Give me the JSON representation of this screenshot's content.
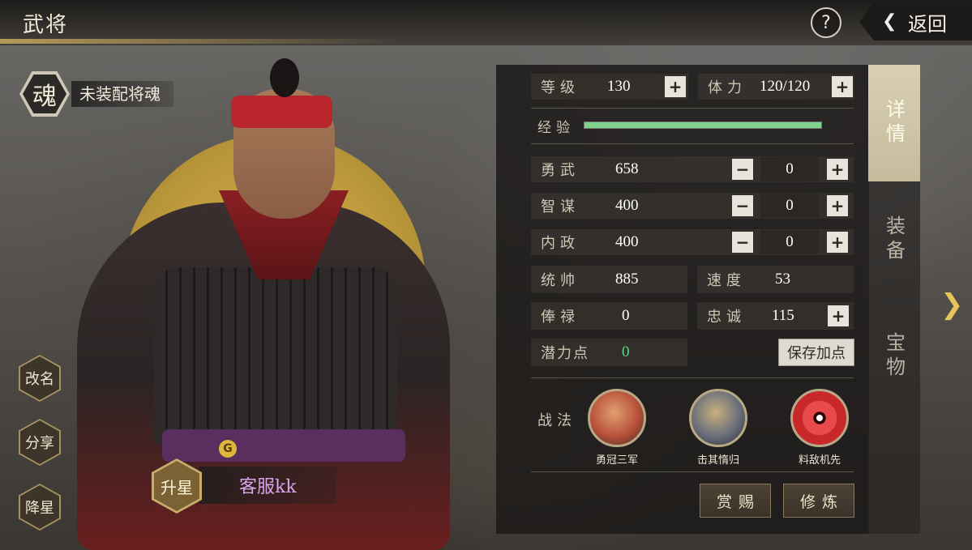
{
  "header": {
    "title": "武将",
    "help_label": "?",
    "back_label": "返回"
  },
  "soul": {
    "icon_char": "魂",
    "status": "未装配将魂"
  },
  "side_buttons": [
    {
      "label": "改名"
    },
    {
      "label": "分享"
    },
    {
      "label": "降星"
    }
  ],
  "general": {
    "star_up_label": "升星",
    "name": "客服kk",
    "rarity_glyph": "G"
  },
  "stats": {
    "level": {
      "label": "等级",
      "value": "130"
    },
    "stamina": {
      "label": "体力",
      "value": "120/120"
    },
    "experience": {
      "label": "经验",
      "progress": 1.0
    },
    "valor": {
      "label": "勇武",
      "value": "658",
      "alloc": "0"
    },
    "intellect": {
      "label": "智谋",
      "value": "400",
      "alloc": "0"
    },
    "politics": {
      "label": "内政",
      "value": "400",
      "alloc": "0"
    },
    "command": {
      "label": "统帅",
      "value": "885"
    },
    "speed": {
      "label": "速度",
      "value": "53"
    },
    "salary": {
      "label": "俸禄",
      "value": "0"
    },
    "loyalty": {
      "label": "忠诚",
      "value": "115"
    },
    "potential": {
      "label": "潜力点",
      "value": "0"
    }
  },
  "buttons": {
    "plus": "+",
    "minus": "−",
    "save": "保存加点",
    "reward": "赏赐",
    "train": "修炼"
  },
  "skills": {
    "label": "战法",
    "items": [
      {
        "name": "勇冠三军",
        "color": "#b8503a"
      },
      {
        "name": "击其惰归",
        "color": "#6a6f7a"
      },
      {
        "name": "料敌机先",
        "color": "#c8282a"
      }
    ]
  },
  "tabs": [
    {
      "label": "详情",
      "active": true
    },
    {
      "label": "装备",
      "active": false
    },
    {
      "label": "宝物",
      "active": false
    }
  ],
  "colors": {
    "accent_gold": "#c9ad6a",
    "exp_green": "#7fd28a",
    "potential_green": "#5fd88a",
    "name_purple": "#d8a6e8"
  }
}
